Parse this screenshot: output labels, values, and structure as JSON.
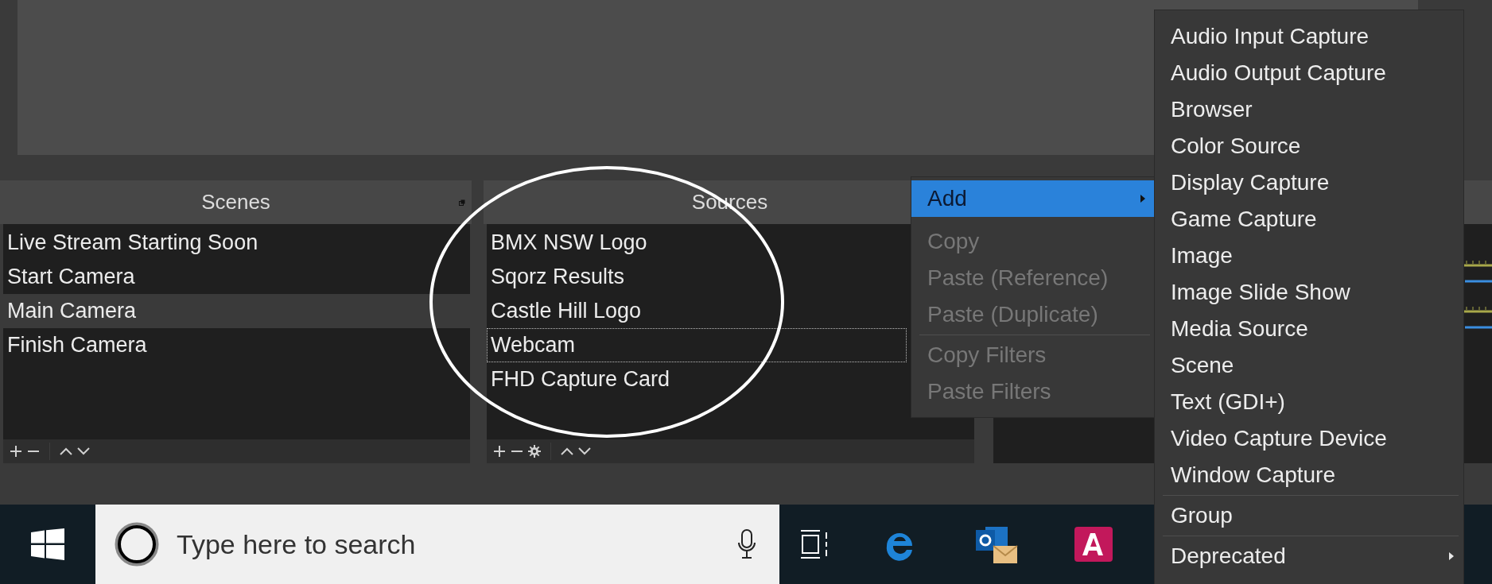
{
  "docks": [
    {
      "title": "Scenes",
      "settings_button": false,
      "items": [
        {
          "label": "Live Stream Starting Soon",
          "selected": false,
          "focused": false
        },
        {
          "label": "Start Camera",
          "selected": false,
          "focused": false
        },
        {
          "label": "Main Camera",
          "selected": true,
          "focused": false
        },
        {
          "label": "Finish Camera",
          "selected": false,
          "focused": false
        }
      ]
    },
    {
      "title": "Sources",
      "settings_button": true,
      "items": [
        {
          "label": "BMX NSW Logo",
          "selected": false,
          "focused": false
        },
        {
          "label": "Sqorz Results",
          "selected": false,
          "focused": false
        },
        {
          "label": "Castle Hill Logo",
          "selected": false,
          "focused": false
        },
        {
          "label": "Webcam",
          "selected": false,
          "focused": true
        },
        {
          "label": "FHD Capture Card",
          "selected": false,
          "focused": false
        }
      ]
    }
  ],
  "context_menu": {
    "items": [
      {
        "kind": "submenu",
        "label": "Add",
        "highlighted": true,
        "disabled": false
      },
      {
        "kind": "item",
        "label": "Copy",
        "highlighted": false,
        "disabled": true
      },
      {
        "kind": "item",
        "label": "Paste (Reference)",
        "highlighted": false,
        "disabled": true
      },
      {
        "kind": "item",
        "label": "Paste (Duplicate)",
        "highlighted": false,
        "disabled": true
      },
      {
        "kind": "separator"
      },
      {
        "kind": "item",
        "label": "Copy Filters",
        "highlighted": false,
        "disabled": true
      },
      {
        "kind": "item",
        "label": "Paste Filters",
        "highlighted": false,
        "disabled": true
      }
    ]
  },
  "add_submenu": {
    "items": [
      {
        "kind": "item",
        "label": "Audio Input Capture"
      },
      {
        "kind": "item",
        "label": "Audio Output Capture"
      },
      {
        "kind": "item",
        "label": "Browser"
      },
      {
        "kind": "item",
        "label": "Color Source"
      },
      {
        "kind": "item",
        "label": "Display Capture"
      },
      {
        "kind": "item",
        "label": "Game Capture"
      },
      {
        "kind": "item",
        "label": "Image"
      },
      {
        "kind": "item",
        "label": "Image Slide Show"
      },
      {
        "kind": "item",
        "label": "Media Source"
      },
      {
        "kind": "item",
        "label": "Scene"
      },
      {
        "kind": "item",
        "label": "Text (GDI+)"
      },
      {
        "kind": "item",
        "label": "Video Capture Device"
      },
      {
        "kind": "item",
        "label": "Window Capture"
      },
      {
        "kind": "separator"
      },
      {
        "kind": "item",
        "label": "Group"
      },
      {
        "kind": "separator"
      },
      {
        "kind": "submenu",
        "label": "Deprecated"
      }
    ]
  },
  "taskbar": {
    "search": {
      "placeholder": "Type here to search"
    }
  }
}
